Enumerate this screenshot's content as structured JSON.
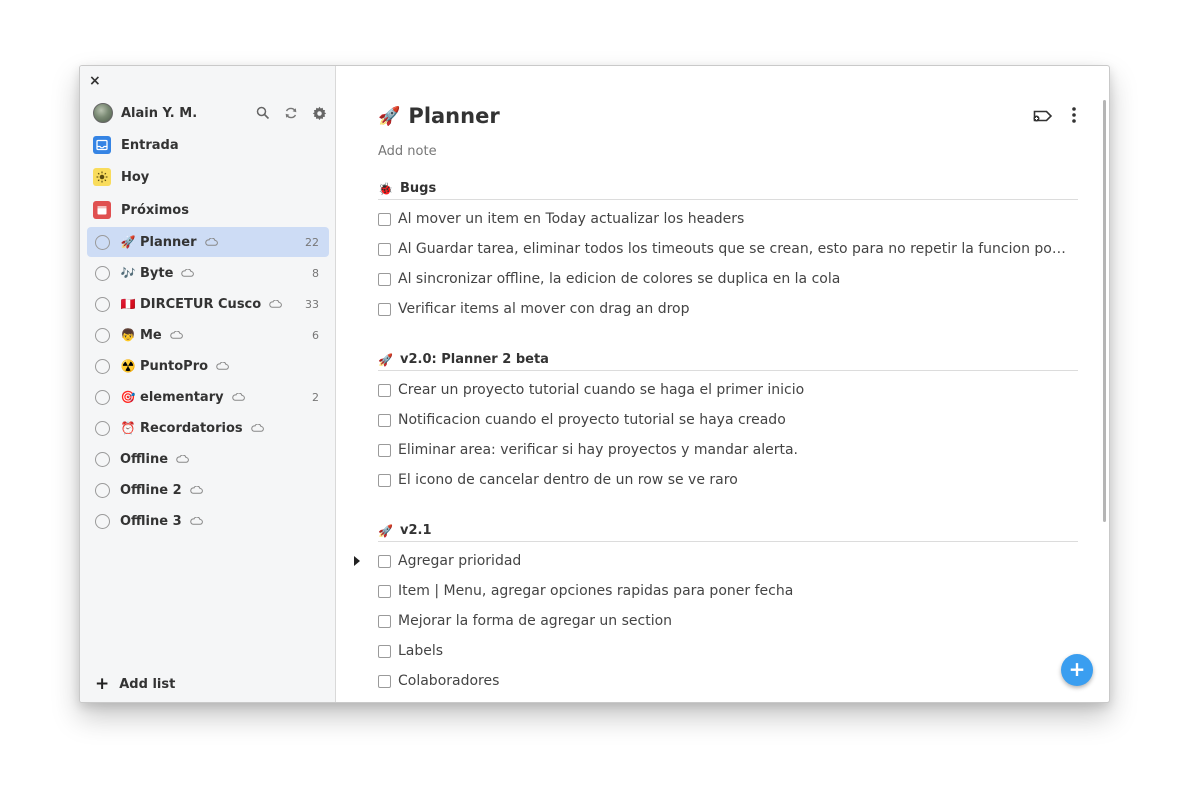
{
  "window": {
    "close_label": "×"
  },
  "sidebar": {
    "user_name": "Alain Y. M.",
    "nav": [
      {
        "label": "Entrada",
        "icon": "inbox-icon",
        "color": "#3584e4"
      },
      {
        "label": "Hoy",
        "icon": "sun-icon",
        "color": "#f9dc5c"
      },
      {
        "label": "Próximos",
        "icon": "calendar-icon",
        "color": "#e05050"
      }
    ],
    "projects": [
      {
        "emoji": "🚀",
        "name": "Planner",
        "count": "22",
        "active": true
      },
      {
        "emoji": "🎶",
        "name": "Byte",
        "count": "8"
      },
      {
        "emoji": "🇵🇪",
        "name": "DIRCETUR Cusco",
        "count": "33"
      },
      {
        "emoji": "👦",
        "name": "Me",
        "count": "6"
      },
      {
        "emoji": "☢️",
        "name": "PuntoPro",
        "count": ""
      },
      {
        "emoji": "🎯",
        "name": "elementary",
        "count": "2"
      },
      {
        "emoji": "⏰",
        "name": "Recordatorios",
        "count": ""
      },
      {
        "emoji": "",
        "name": "Offline",
        "count": ""
      },
      {
        "emoji": "",
        "name": "Offline 2",
        "count": ""
      },
      {
        "emoji": "",
        "name": "Offline 3",
        "count": ""
      }
    ],
    "add_list_label": "Add list",
    "add_list_icon": "+"
  },
  "main": {
    "title_emoji": "🚀",
    "title": "Planner",
    "add_note": "Add note",
    "fab_label": "+",
    "sections": [
      {
        "emoji": "🐞",
        "name": "Bugs",
        "tasks": [
          "Al mover un item en Today actualizar los headers",
          "Al Guardar tarea, eliminar todos los timeouts que se crean, esto para no repetir la funcion por segundo",
          "Al sincronizar offline, la edicion de colores se duplica en la cola",
          "Verificar items al mover con drag an drop"
        ]
      },
      {
        "emoji": "🚀",
        "name": "v2.0: Planner 2 beta",
        "tasks": [
          "Crear un proyecto tutorial cuando se haga el primer inicio",
          "Notificacion cuando el proyecto tutorial se haya creado",
          "Eliminar area: verificar si hay proyectos y mandar alerta.",
          "El icono de cancelar dentro de un row se ve raro"
        ]
      },
      {
        "emoji": "🚀",
        "name": "v2.1",
        "tasks": [
          "Agregar prioridad",
          "Item | Menu, agregar opciones rapidas para poner fecha",
          "Mejorar la forma de agregar un section",
          "Labels",
          "Colaboradores"
        ]
      }
    ]
  }
}
